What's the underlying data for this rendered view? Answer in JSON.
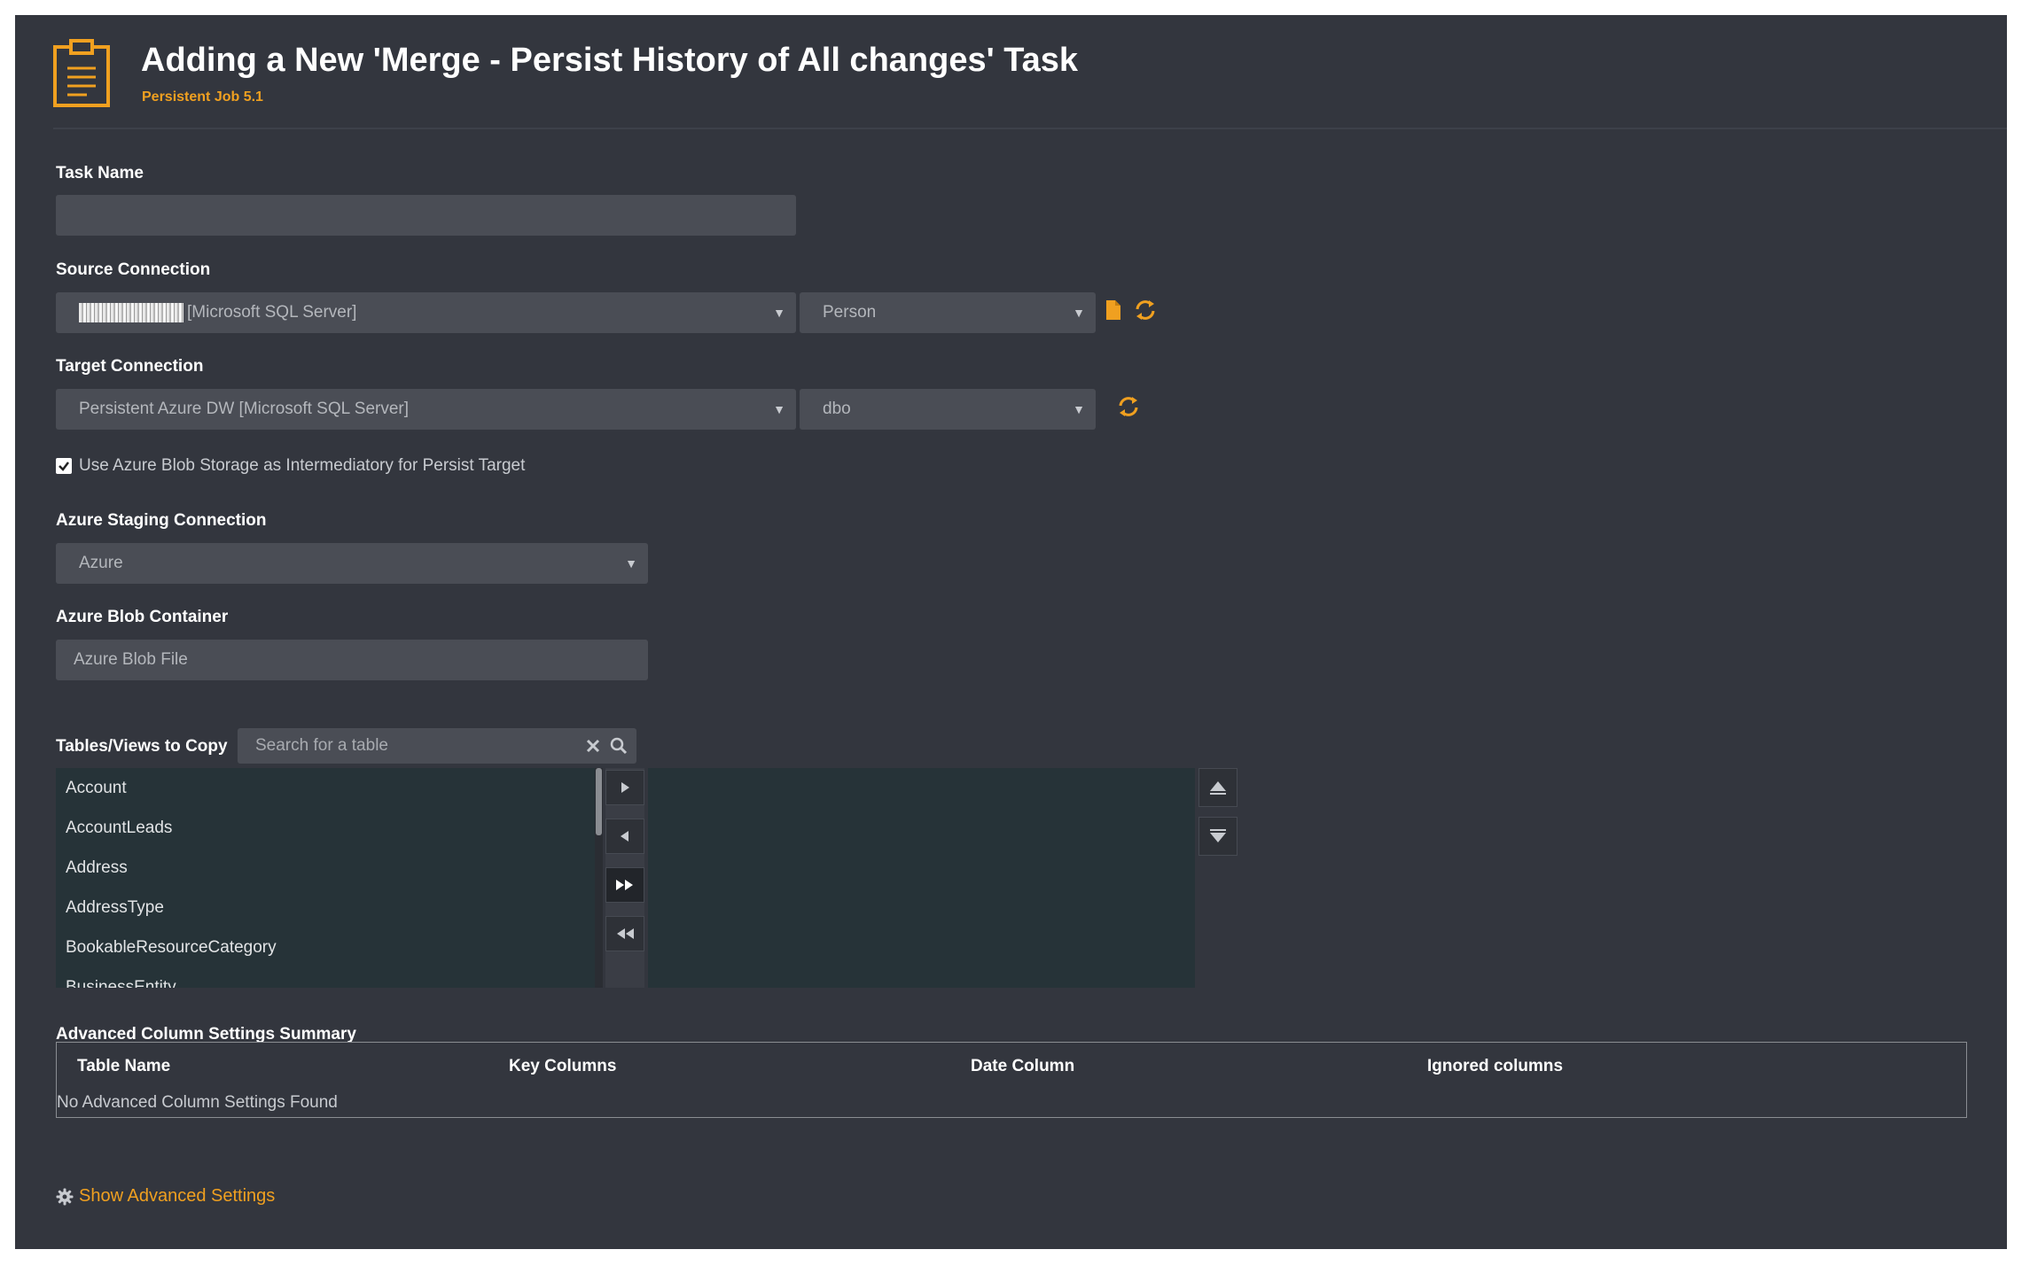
{
  "header": {
    "title": "Adding a New 'Merge - Persist History of All changes' Task",
    "subtitle": "Persistent Job 5.1",
    "icon": "clipboard-icon"
  },
  "task_name": {
    "label": "Task Name",
    "value": ""
  },
  "source_connection": {
    "label": "Source Connection",
    "connection_suffix": "[Microsoft SQL Server]",
    "schema": "Person"
  },
  "target_connection": {
    "label": "Target Connection",
    "connection": "Persistent Azure DW [Microsoft SQL Server]",
    "schema": "dbo"
  },
  "use_blob": {
    "label": "Use Azure Blob Storage as Intermediatory for Persist Target",
    "checked": true
  },
  "azure_staging": {
    "label": "Azure Staging Connection",
    "value": "Azure"
  },
  "azure_blob": {
    "label": "Azure Blob Container",
    "placeholder": "Azure Blob File"
  },
  "tables": {
    "label": "Tables/Views to Copy",
    "search_placeholder": "Search for a table",
    "items": [
      "Account",
      "AccountLeads",
      "Address",
      "AddressType",
      "BookableResourceCategory",
      "BusinessEntity"
    ]
  },
  "summary": {
    "label": "Advanced Column Settings Summary",
    "columns": [
      "Table Name",
      "Key Columns",
      "Date Column",
      "Ignored columns"
    ],
    "empty_message": "No Advanced Column Settings Found"
  },
  "advanced_link": "Show Advanced Settings",
  "colors": {
    "background": "#33363e",
    "accent": "#f0a020",
    "field": "#4a4d55",
    "list": "#263338"
  }
}
